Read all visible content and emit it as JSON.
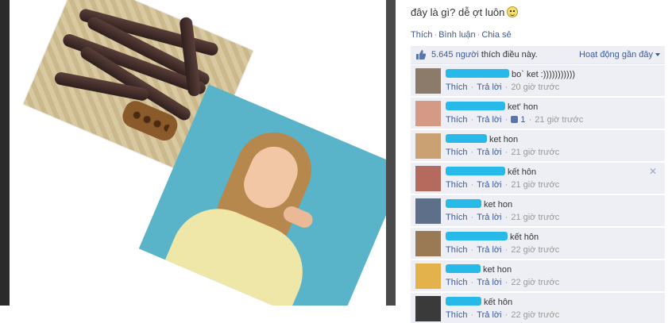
{
  "post": {
    "caption": "đây là gì? dễ ợt luôn",
    "actions": {
      "like": "Thích",
      "comment": "Bình luận",
      "share": "Chia sẻ"
    },
    "likes": {
      "count": "5.645 người",
      "suffix": "thích điều này."
    },
    "activity_label": "Hoạt động gần đây"
  },
  "comments": [
    {
      "text": "bo` ket :)))))))))))",
      "like": "Thích",
      "reply": "Trả lời",
      "time": "20 giờ trước",
      "avatar_color": "#8c7b6a"
    },
    {
      "text": "ket' hon",
      "like": "Thích",
      "reply": "Trả lời",
      "likes": "1",
      "time": "21 giờ trước",
      "avatar_color": "#d49a86"
    },
    {
      "text": "ket hon",
      "like": "Thích",
      "reply": "Trả lời",
      "time": "21 giờ trước",
      "avatar_color": "#c9a173"
    },
    {
      "text": "kết hôn",
      "like": "Thích",
      "reply": "Trả lời",
      "time": "21 giờ trước",
      "avatar_color": "#b46b5e"
    },
    {
      "text": "ket hon",
      "like": "Thích",
      "reply": "Trả lời",
      "time": "21 giờ trước",
      "avatar_color": "#5e6f8a"
    },
    {
      "text": "kết hôn",
      "like": "Thích",
      "reply": "Trả lời",
      "time": "22 giờ trước",
      "avatar_color": "#9a7a55"
    },
    {
      "text": "ket hon",
      "like": "Thích",
      "reply": "Trả lời",
      "time": "22 giờ trước",
      "avatar_color": "#e3b24a"
    },
    {
      "text": "kết hôn",
      "like": "Thích",
      "reply": "Trả lời",
      "time": "22 giờ trước",
      "avatar_color": "#3a3a3a"
    }
  ],
  "colors": {
    "link": "#3b5998",
    "panel": "#edeff4",
    "redaction": "#27b9e8"
  }
}
